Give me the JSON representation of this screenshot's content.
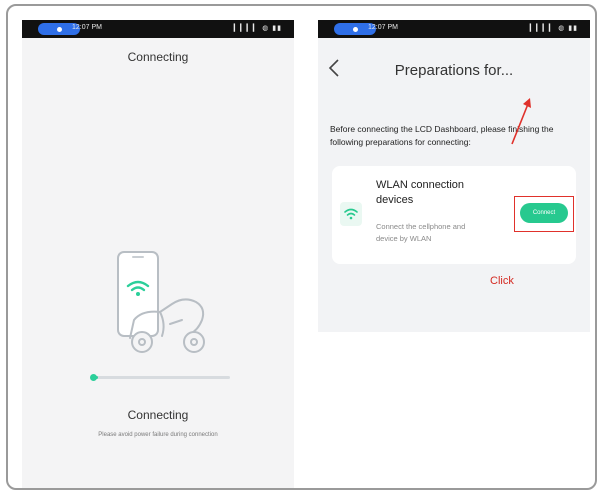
{
  "status_bar": {
    "time": "12:07 PM",
    "icons_text": "⚙ ◎ ▫",
    "right_indicators": "▎▎▎▎  ◍  ▮▮"
  },
  "screen1": {
    "title": "Connecting",
    "status_label": "Connecting",
    "hint": "Please avoid power failure during connection",
    "progress": 0.04
  },
  "screen2": {
    "back_icon": "chevron-left-icon",
    "title": "Preparations for...",
    "intro": "Before connecting the LCD Dashboard, please finishing the following preparations for connecting:",
    "card": {
      "icon": "wifi-icon",
      "title": "WLAN connection devices",
      "description": "Connect the cellphone and device by WLAN",
      "button_label": "Connect"
    },
    "annotation_label": "Click"
  },
  "colors": {
    "accent": "#27c98f",
    "annotation": "#e0312b",
    "status_pill": "#2f6fe8"
  }
}
